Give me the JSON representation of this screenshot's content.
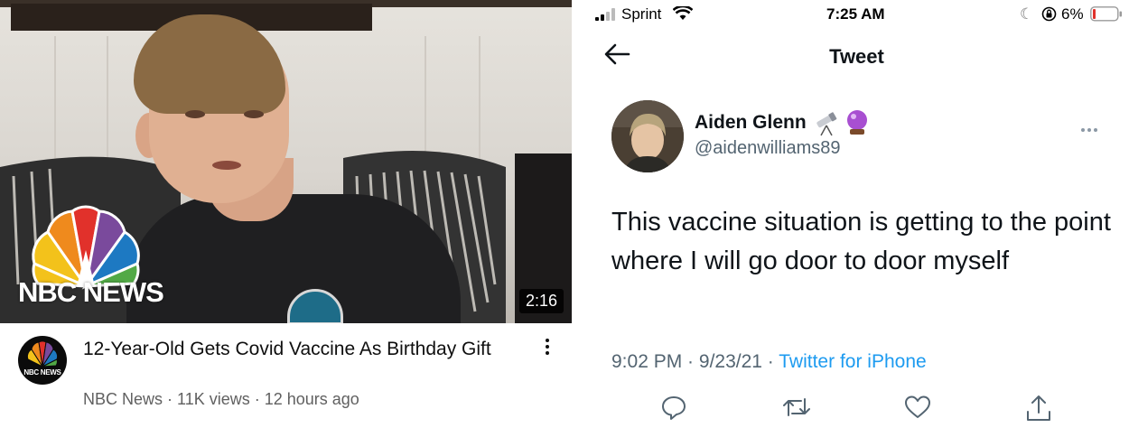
{
  "youtube": {
    "thumbnail_logo_text": "NBC NEWS",
    "duration": "2:16",
    "channel_avatar_text": "NBC NEWS",
    "title": "12-Year-Old Gets Covid Vaccine As Birthday Gift",
    "channel": "NBC News",
    "views": "11K views",
    "age": "12 hours ago",
    "separator": " · "
  },
  "status_bar": {
    "carrier": "Sprint",
    "time": "7:25 AM",
    "battery": "6%",
    "battery_color": "#e0332c"
  },
  "twitter": {
    "header_title": "Tweet",
    "display_name": "Aiden Glenn",
    "handle": "@aidenwilliams89",
    "text": "This vaccine situation is getting to the point where I will go door to door myself",
    "time": "9:02 PM",
    "date": "9/23/21",
    "separator": " · ",
    "source": "Twitter for iPhone",
    "accent": "#1d9bf0",
    "icons": [
      "reply-icon",
      "retweet-icon",
      "like-icon",
      "share-icon"
    ]
  }
}
